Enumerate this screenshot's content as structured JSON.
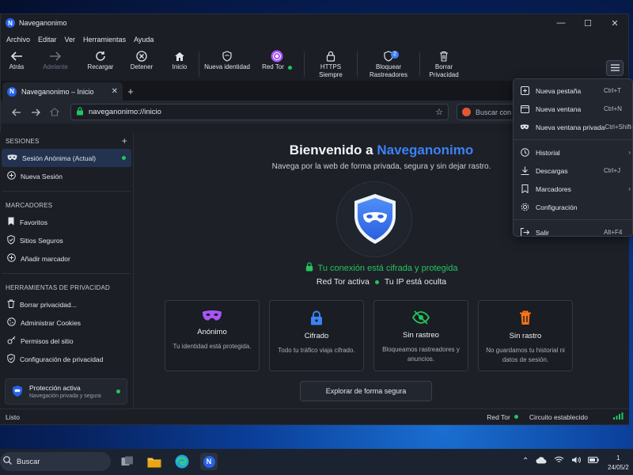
{
  "window": {
    "title": "Naveganonimo",
    "logo_letter": "N"
  },
  "menu": [
    "Archivo",
    "Editar",
    "Ver",
    "Herramientas",
    "Ayuda"
  ],
  "toolbar": {
    "back": "Atrás",
    "forward": "Adelante",
    "reload": "Recargar",
    "stop": "Detener",
    "home": "Inicio",
    "new_identity": "Nueva identidad",
    "tor_network": "Red Tor",
    "https_1": "HTTPS",
    "https_2": "Siempre",
    "block_1": "Bloquear",
    "block_2": "Rastreadores",
    "blocked_count": "2",
    "clear_1": "Borrar",
    "clear_2": "Privacidad"
  },
  "tab": {
    "title": "Naveganonimo – Inicio",
    "new_tab_symbol": "+"
  },
  "address": {
    "url": "naveganonimo://inicio",
    "search_placeholder": "Buscar con DuckDuckGo"
  },
  "sidebar": {
    "sessions_header": "SESIONES",
    "add_symbol": "+",
    "active_session": "Sesión Anónima (Actual)",
    "new_session": "Nueva Sesión",
    "bookmarks_header": "MARCADORES",
    "favorites": "Favoritos",
    "safe_sites": "Sitios Seguros",
    "add_bookmark": "Añadir marcador",
    "tools_header": "HERRAMIENTAS DE PRIVACIDAD",
    "clear_privacy": "Borrar privacidad...",
    "manage_cookies": "Administrar Cookies",
    "site_permissions": "Permisos del sitio",
    "privacy_settings": "Configuración de privacidad",
    "protection_title": "Protección activa",
    "protection_sub": "Navegación privada y segura"
  },
  "content": {
    "welcome_prefix": "Bienvenido a",
    "welcome_brand": "Naveganonimo",
    "subtitle": "Navega por la web de forma privada, segura y sin dejar rastro.",
    "secure_text": "Tu conexión está cifrada y protegida",
    "tor_active": "Red Tor activa",
    "ip_hidden": "Tu IP está oculta",
    "cards": [
      {
        "title": "Anónimo",
        "desc": "Tu identidad está protegida."
      },
      {
        "title": "Cifrado",
        "desc": "Todo tu tráfico viaja cifrado."
      },
      {
        "title": "Sin rastreo",
        "desc": "Bloqueamos rastreadores y anuncios."
      },
      {
        "title": "Sin rastro",
        "desc": "No guardamos tu historial ni datos de sesión."
      }
    ],
    "explore_button": "Explorar de forma segura"
  },
  "status": {
    "ready": "Listo",
    "tor": "Red Tor",
    "circuit": "Circuito establecido"
  },
  "dropdown": [
    {
      "label": "Nueva pestaña",
      "shortcut": "Ctrl+T"
    },
    {
      "label": "Nueva ventana",
      "shortcut": "Ctrl+N"
    },
    {
      "label": "Nueva ventana privada",
      "shortcut": "Ctrl+Shift+N"
    },
    {
      "label": "Historial",
      "shortcut": ""
    },
    {
      "label": "Descargas",
      "shortcut": "Ctrl+J"
    },
    {
      "label": "Marcadores",
      "shortcut": ""
    },
    {
      "label": "Configuración",
      "shortcut": ""
    },
    {
      "label": "Salir",
      "shortcut": "Alt+F4"
    }
  ],
  "taskbar": {
    "search": "Buscar",
    "time": "1",
    "date": "24/05/2"
  },
  "colors": {
    "accent": "#3b82f6",
    "green": "#22c55e",
    "purple": "#a855f7",
    "orange": "#f97316"
  }
}
